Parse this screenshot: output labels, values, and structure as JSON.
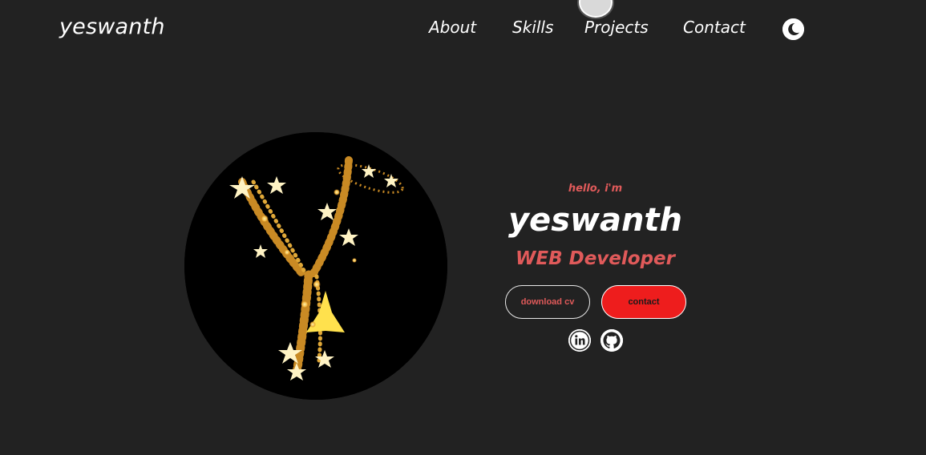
{
  "header": {
    "logo": "yeswanth",
    "nav": [
      {
        "label": "About"
      },
      {
        "label": "Skills"
      },
      {
        "label": "Projects"
      },
      {
        "label": "Contact"
      }
    ],
    "theme_icon": "moon-icon"
  },
  "hero": {
    "greeting": "hello, i'm",
    "name": "yeswanth",
    "role": "WEB Developer",
    "buttons": {
      "download_cv": "download cv",
      "contact": "contact"
    },
    "social": [
      "linkedin-icon",
      "github-icon"
    ],
    "profile_image": "Y letter made of sparkling stars on black background"
  },
  "colors": {
    "background": "#222222",
    "accent": "#e05a5a",
    "button_red": "#ee1d1d",
    "text": "#ffffff"
  }
}
